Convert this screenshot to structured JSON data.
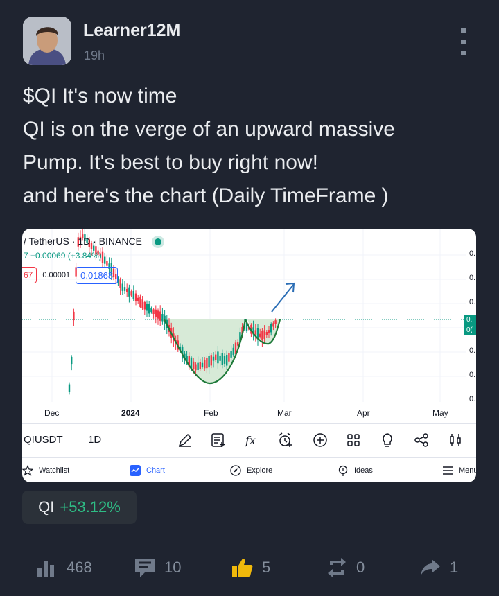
{
  "post": {
    "author": "Learner12M",
    "time": "19h",
    "lines": [
      "$QI It's now time",
      "QI is on the verge of an upward massive",
      "Pump. It's best to buy right now!",
      "and here's the chart (Daily TimeFrame )"
    ]
  },
  "chart": {
    "header_title": "/ TetherUS · 1D · BINANCE",
    "header_change": "7  +0.00069 (+3.84%)",
    "sell_price": "67",
    "spread": "0.00001",
    "buy_price": "0.01868",
    "x_labels": [
      "Dec",
      "2024",
      "Feb",
      "Mar",
      "Apr",
      "May"
    ],
    "y_labels": [
      "0.",
      "0.",
      "0.",
      "0.",
      "0.",
      "0.",
      "0."
    ],
    "price_tag": [
      "0.",
      "0("
    ],
    "symbol": "QIUSDT",
    "timeframe": "1D",
    "toolbar_icons": [
      "pencil-icon",
      "note-plus-icon",
      "fx-icon",
      "alarm-plus-icon",
      "plus-circle-icon",
      "grid-icon",
      "lightbulb-icon",
      "share-nodes-icon",
      "candles-icon"
    ],
    "nav": {
      "watchlist": "Watchlist",
      "chart": "Chart",
      "explore": "Explore",
      "ideas": "Ideas",
      "menu": "Menu"
    },
    "colors": {
      "up": "#089981",
      "down": "#f23645",
      "pattern": "#1f7a3a",
      "arrow": "#2a6db5"
    }
  },
  "ticker": {
    "symbol": "QI",
    "change": "+53.12%"
  },
  "actions": {
    "views": "468",
    "comments": "10",
    "likes": "5",
    "reposts": "0",
    "shares": "1"
  },
  "colors": {
    "background": "#1f2430",
    "positive": "#2ebd85",
    "like": "#f0b90b"
  }
}
